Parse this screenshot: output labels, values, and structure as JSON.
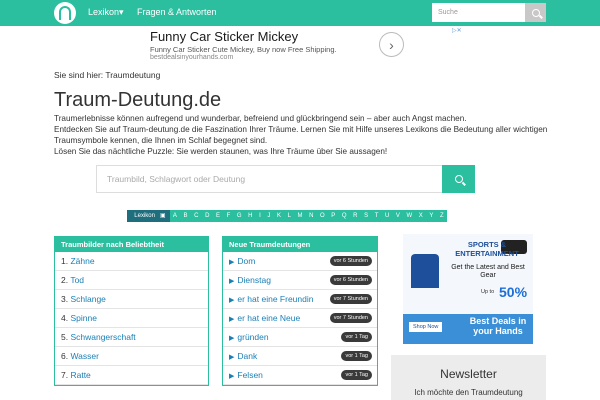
{
  "nav": {
    "items": [
      "Lexikon",
      "Fragen & Antworten"
    ],
    "search_placeholder": "Suche"
  },
  "ad": {
    "title": "Funny Car Sticker Mickey",
    "desc": "Funny Car Sticker Cute Mickey, Buy now Free Shipping.",
    "url": "bestdealsinyourhands.com"
  },
  "breadcrumb": "Sie sind hier: Traumdeutung",
  "page_title": "Traum-Deutung.de",
  "intro": [
    "Traumerlebnisse können aufregend und wunderbar, befreiend und glückbringend sein – aber auch Angst machen.",
    "Entdecken Sie auf Traum-deutung.de die Faszination Ihrer Träume. Lernen Sie mit Hilfe unseres Lexikons die Bedeutung aller wichtigen Traumsymbole kennen, die Ihnen im Schlaf begegnet sind.",
    "Lösen Sie das nächtliche Puzzle: Sie werden staunen, was Ihre Träume über Sie aussagen!"
  ],
  "main_search_placeholder": "Traumbild, Schlagwort oder Deutung",
  "alphabet": {
    "lexikon_label": "Lexikon",
    "letters": [
      "A",
      "B",
      "C",
      "D",
      "E",
      "F",
      "G",
      "H",
      "I",
      "J",
      "K",
      "L",
      "M",
      "N",
      "O",
      "P",
      "Q",
      "R",
      "S",
      "T",
      "U",
      "V",
      "W",
      "X",
      "Y",
      "Z"
    ]
  },
  "popular": {
    "title": "Traumbilder nach Beliebtheit",
    "items": [
      {
        "num": "1.",
        "label": "Zähne"
      },
      {
        "num": "2.",
        "label": "Tod"
      },
      {
        "num": "3.",
        "label": "Schlange"
      },
      {
        "num": "4.",
        "label": "Spinne"
      },
      {
        "num": "5.",
        "label": "Schwangerschaft"
      },
      {
        "num": "6.",
        "label": "Wasser"
      },
      {
        "num": "7.",
        "label": "Ratte"
      }
    ]
  },
  "recent": {
    "title": "Neue Traumdeutungen",
    "items": [
      {
        "label": "Dom",
        "time": "vor 6 Stunden"
      },
      {
        "label": "Dienstag",
        "time": "vor 6 Stunden"
      },
      {
        "label": "er hat eine Freundin",
        "time": "vor 7 Stunden"
      },
      {
        "label": "er hat eine Neue",
        "time": "vor 7 Stunden"
      },
      {
        "label": "gründen",
        "time": "vor 1 Tag"
      },
      {
        "label": "Dank",
        "time": "vor 1 Tag"
      },
      {
        "label": "Felsen",
        "time": "vor 1 Tag"
      }
    ]
  },
  "sidead": {
    "top": "SPORTS & ENTERTAINMENT",
    "sub": "Get the Latest and Best Gear",
    "upto": "Up to",
    "pct": "50%",
    "shop": "Shop Now",
    "best": "Best Deals in your Hands"
  },
  "newsletter": {
    "title": "Newsletter",
    "text": "Ich möchte den Traumdeutung"
  }
}
